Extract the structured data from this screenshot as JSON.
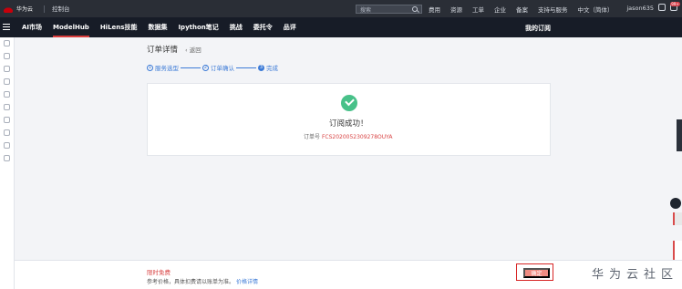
{
  "topbar": {
    "brand": "华为云",
    "console": "控制台",
    "search_placeholder": "搜索",
    "nav": [
      "费用",
      "资源",
      "工单",
      "企业",
      "备案",
      "支持与服务",
      "中文（简体）"
    ],
    "user": "jason635",
    "badge": "99+"
  },
  "secondbar": {
    "tabs": [
      "AI市场",
      "ModelHub",
      "HiLens技能",
      "数据集",
      "Ipython笔记",
      "挑战",
      "委托令",
      "品评"
    ],
    "active_tab": "ModelHub",
    "my_orders": "我的订阅"
  },
  "page": {
    "title": "订单详情",
    "back": "返回",
    "steps": [
      {
        "num": "1",
        "label": "服务选型"
      },
      {
        "num": "2",
        "label": "订单确认"
      },
      {
        "num": "3",
        "label": "完成"
      }
    ],
    "success": "订阅成功！",
    "order_label": "订单号",
    "order_number": "FCS2020052309278OUYA"
  },
  "footer": {
    "free": "限时免费",
    "note": "参考价格，具体扣费请以账单为准。",
    "price_link": "价格详情",
    "confirm": "确定",
    "watermark": "华为云社区"
  },
  "colors": {
    "topbar": "#2a2e36",
    "secondbar": "#171c27",
    "accent_blue": "#3d7bd7",
    "success_green": "#48c189",
    "alert_red": "#d94444"
  }
}
